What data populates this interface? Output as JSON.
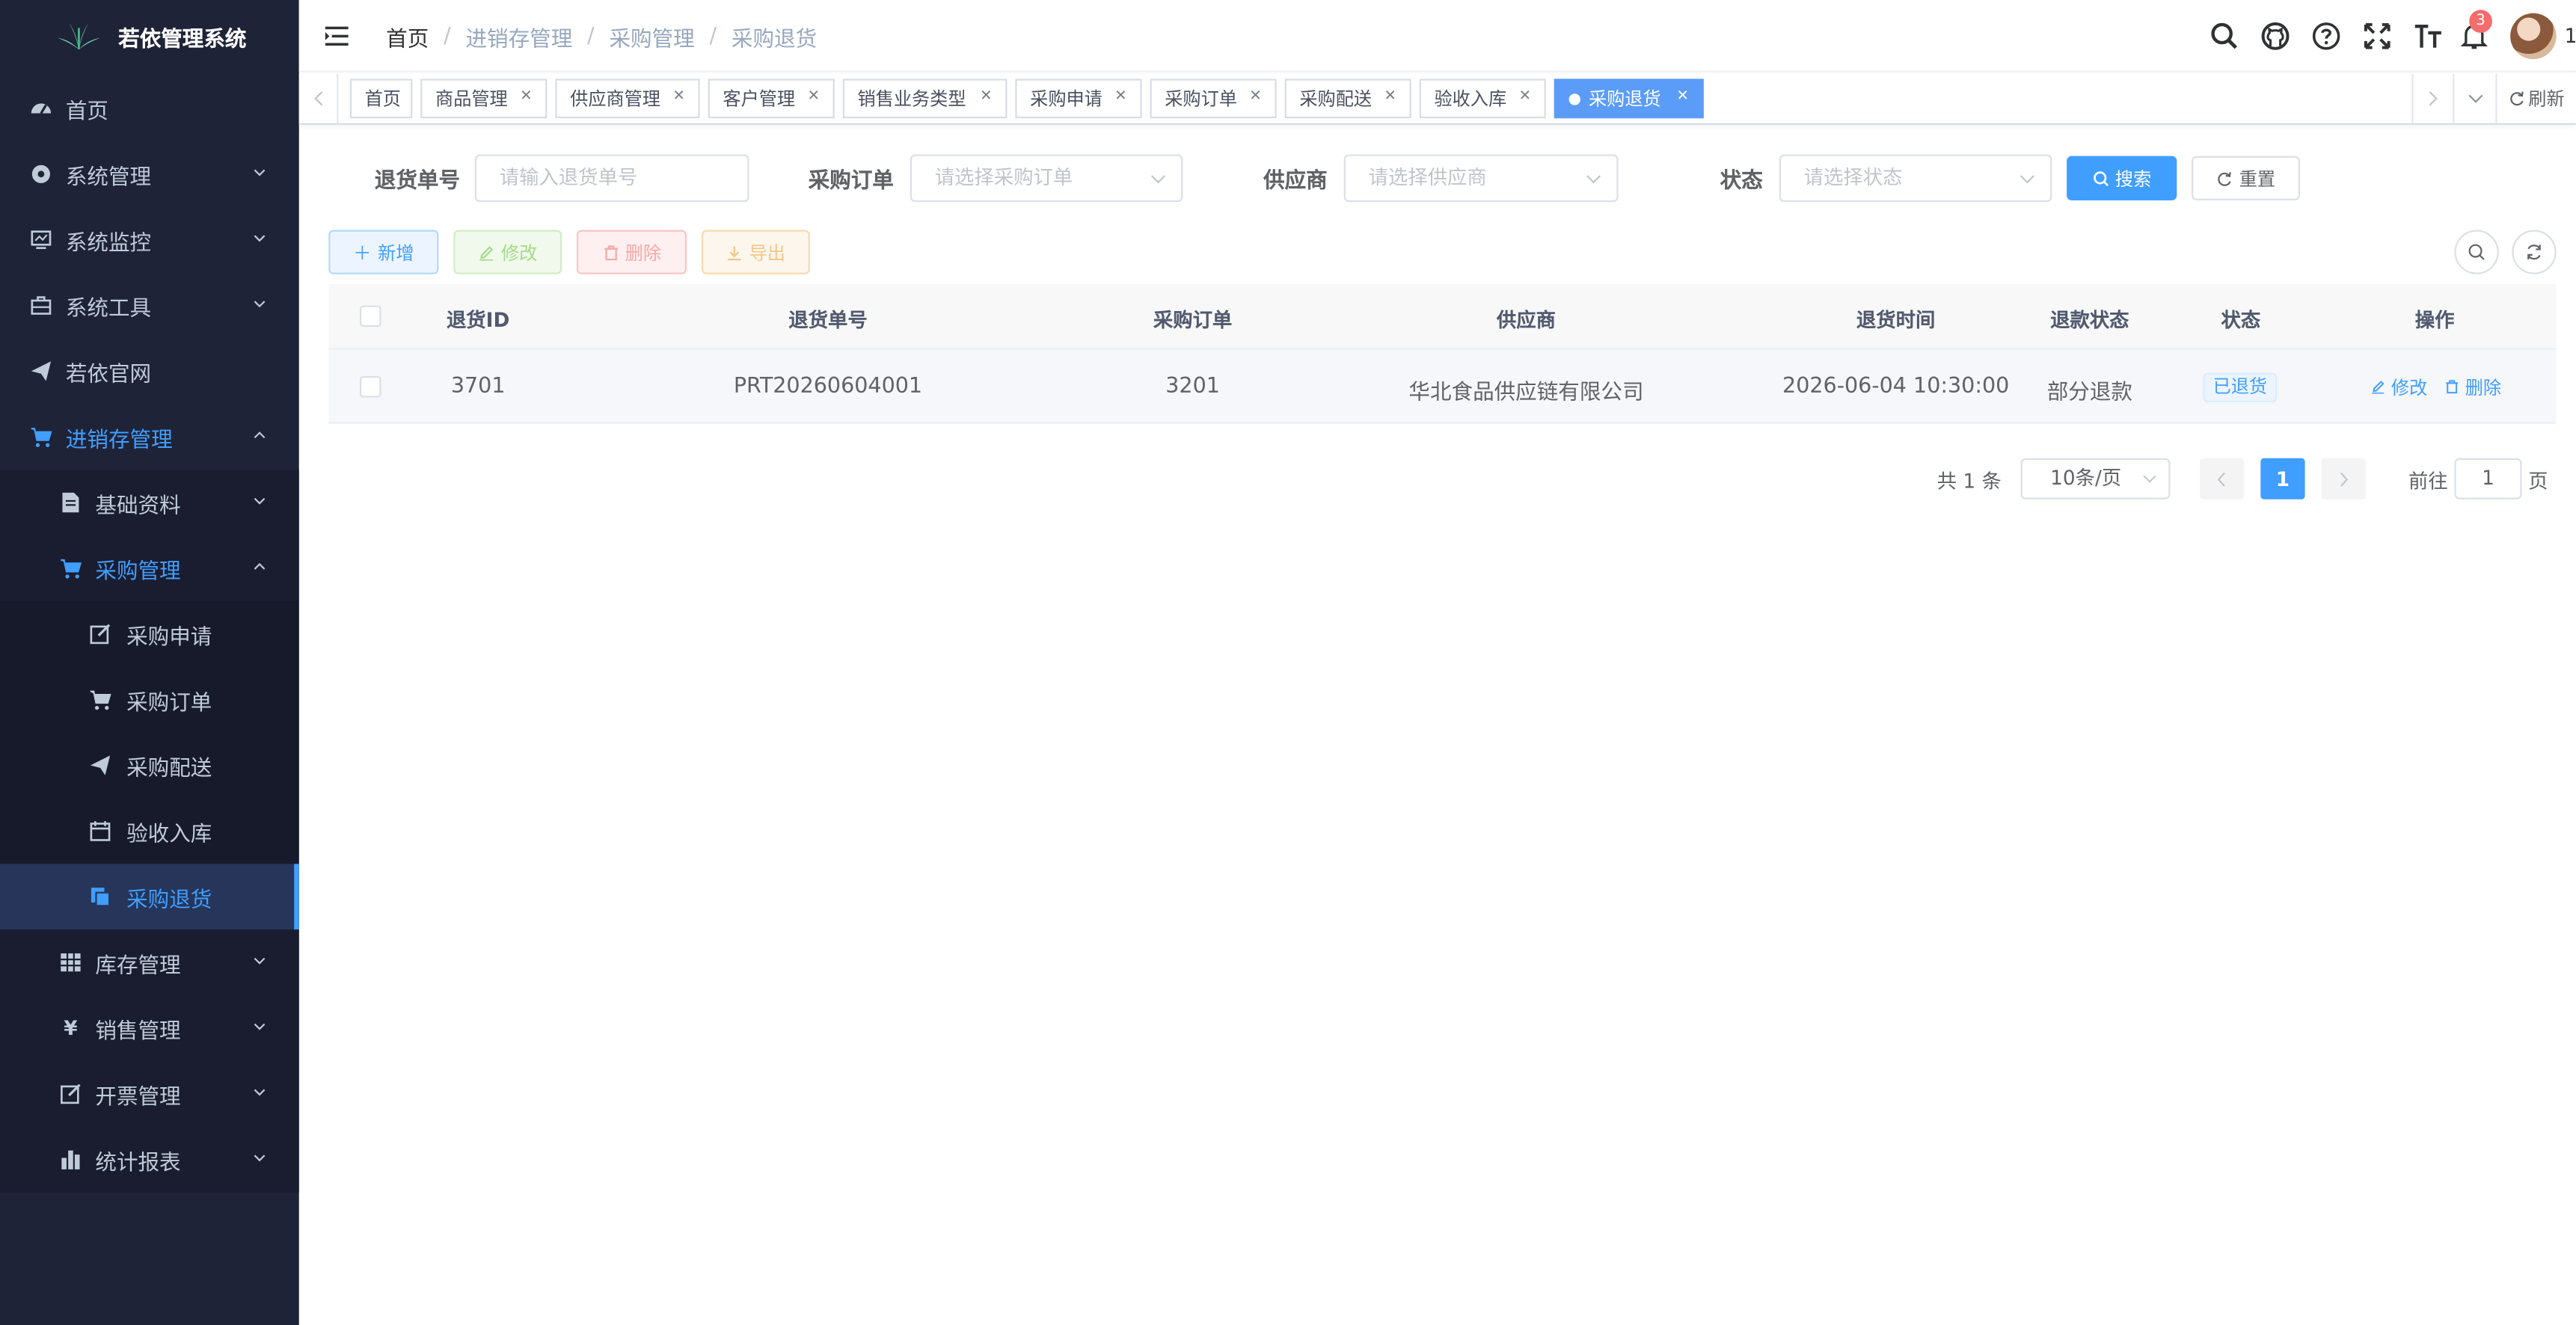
{
  "app": {
    "title": "若依管理系统"
  },
  "sidebar": {
    "home": "首页",
    "system_mgmt": "系统管理",
    "system_monitor": "系统监控",
    "system_tools": "系统工具",
    "ruoyi_site": "若依官网",
    "psi_mgmt": "进销存管理",
    "basic_data": "基础资料",
    "purchase_mgmt": "采购管理",
    "purchase_request": "采购申请",
    "purchase_order": "采购订单",
    "purchase_delivery": "采购配送",
    "receiving_storage": "验收入库",
    "purchase_return": "采购退货",
    "inventory_mgmt": "库存管理",
    "sales_mgmt": "销售管理",
    "invoice_mgmt": "开票管理",
    "stats_reports": "统计报表"
  },
  "navbar": {
    "breadcrumb": [
      "首页",
      "进销存管理",
      "采购管理",
      "采购退货"
    ],
    "notification_count": "3",
    "user_suffix": "1"
  },
  "tags": {
    "items": [
      "首页",
      "商品管理",
      "供应商管理",
      "客户管理",
      "销售业务类型",
      "采购申请",
      "采购订单",
      "采购配送",
      "验收入库",
      "采购退货"
    ],
    "refresh": "刷新"
  },
  "search": {
    "return_no_label": "退货单号",
    "return_no_placeholder": "请输入退货单号",
    "order_label": "采购订单",
    "order_placeholder": "请选择采购订单",
    "supplier_label": "供应商",
    "supplier_placeholder": "请选择供应商",
    "status_label": "状态",
    "status_placeholder": "请选择状态",
    "search_btn": "搜索",
    "reset_btn": "重置"
  },
  "toolbar": {
    "add": "新增",
    "edit": "修改",
    "delete": "删除",
    "export": "导出"
  },
  "table": {
    "headers": [
      "退货ID",
      "退货单号",
      "采购订单",
      "供应商",
      "退货时间",
      "退款状态",
      "状态",
      "操作"
    ],
    "rows": [
      {
        "id": "3701",
        "return_no": "PRT20260604001",
        "order": "3201",
        "supplier": "华北食品供应链有限公司",
        "time": "2026-06-04 10:30:00",
        "refund_status": "部分退款",
        "status": "已退货",
        "edit": "修改",
        "delete": "删除"
      }
    ]
  },
  "pagination": {
    "total": "共 1 条",
    "page_size": "10条/页",
    "current": "1",
    "goto_prefix": "前往",
    "goto_value": "1",
    "goto_suffix": "页"
  },
  "colors": {
    "primary": "#409eff",
    "sidebar_bg": "#1f2337",
    "active_tag": "#5a9cf8"
  }
}
